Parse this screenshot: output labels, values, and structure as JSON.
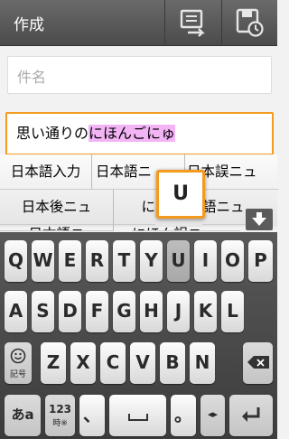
{
  "app": {
    "title": "作成",
    "attach_icon": "attach-icon",
    "save_icon": "save-draft-icon"
  },
  "compose": {
    "subject_placeholder": "件名",
    "body_text_fixed": "思い通りの",
    "body_text_composing": "にほんごにゅ",
    "accent_color": "#f39a1f",
    "composing_color": "#f3b4f6"
  },
  "candidates": {
    "row1": [
      "日本語入力",
      "日本語ニ",
      "日本誤ニュ"
    ],
    "row2": [
      "日本後ニュ",
      "に",
      "語ニュ"
    ],
    "row3": [
      "日本語ニ",
      "にほん誤ニ"
    ]
  },
  "key_popup": "U",
  "keyboard": {
    "row1": [
      "Q",
      "W",
      "E",
      "R",
      "T",
      "Y",
      "U",
      "I",
      "O",
      "P"
    ],
    "row2": [
      "A",
      "S",
      "D",
      "F",
      "G",
      "H",
      "J",
      "K",
      "L"
    ],
    "row3": [
      "Z",
      "X",
      "C",
      "V",
      "B",
      "N",
      "M"
    ],
    "emoji_label": "記号",
    "kana_label": "あa",
    "num_label": "123",
    "num_sub": "時※",
    "comma": "、",
    "period": "。",
    "cursor_label": "◂▸"
  }
}
